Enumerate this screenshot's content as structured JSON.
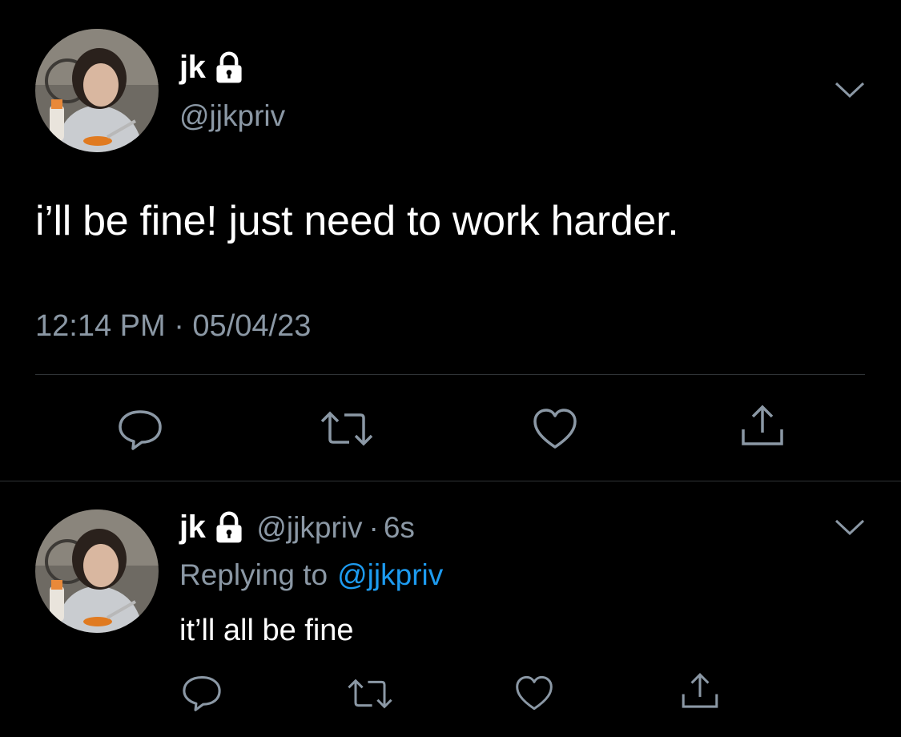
{
  "main_tweet": {
    "display_name": "jk",
    "handle": "@jjkpriv",
    "text": "i’ll be fine! just need to work harder.",
    "timestamp": "12:14 PM · 05/04/23",
    "avatar_icon": "profile-photo",
    "lock_icon": "lock-icon",
    "menu_icon": "chevron-down-icon"
  },
  "actions": {
    "reply_icon": "reply-icon",
    "retweet_icon": "retweet-icon",
    "like_icon": "heart-icon",
    "share_icon": "share-icon"
  },
  "reply_tweet": {
    "display_name": "jk",
    "handle": "@jjkpriv",
    "separator": "·",
    "age": "6s",
    "replying_prefix": "Replying to",
    "replying_handle": "@jjkpriv",
    "text": "it’ll all be fine"
  },
  "colors": {
    "background": "#000000",
    "text": "#ffffff",
    "muted": "#8b98a5",
    "link": "#1d9bf0",
    "divider": "#2f3336"
  }
}
